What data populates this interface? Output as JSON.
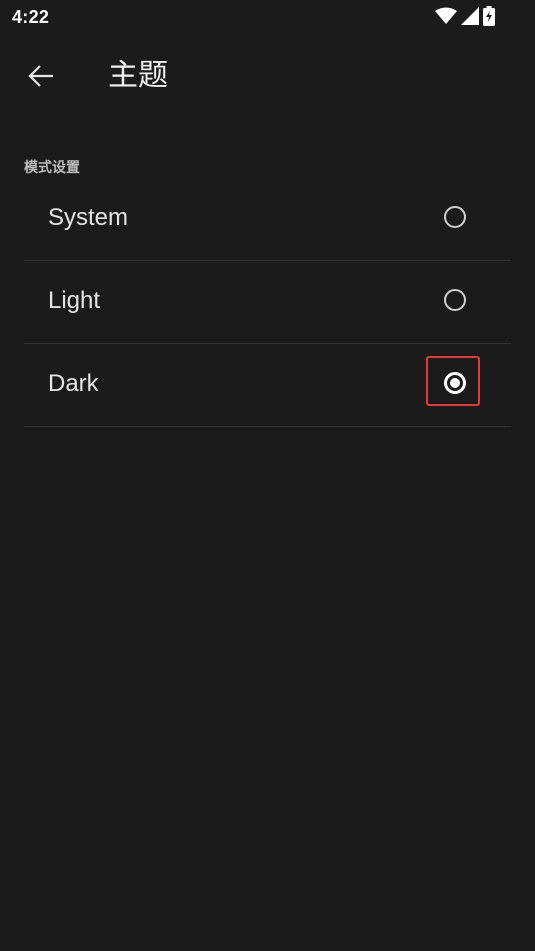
{
  "status_bar": {
    "time": "4:22",
    "icons": [
      "wifi-icon",
      "cell-signal-icon",
      "battery-charging-icon"
    ]
  },
  "app_bar": {
    "back_icon": "arrow-back-icon",
    "title": "主题"
  },
  "section": {
    "header": "模式设置"
  },
  "options": [
    {
      "label": "System",
      "selected": false
    },
    {
      "label": "Light",
      "selected": false
    },
    {
      "label": "Dark",
      "selected": true
    }
  ],
  "colors": {
    "background": "#1b1b1b",
    "highlight": "#e53935"
  }
}
